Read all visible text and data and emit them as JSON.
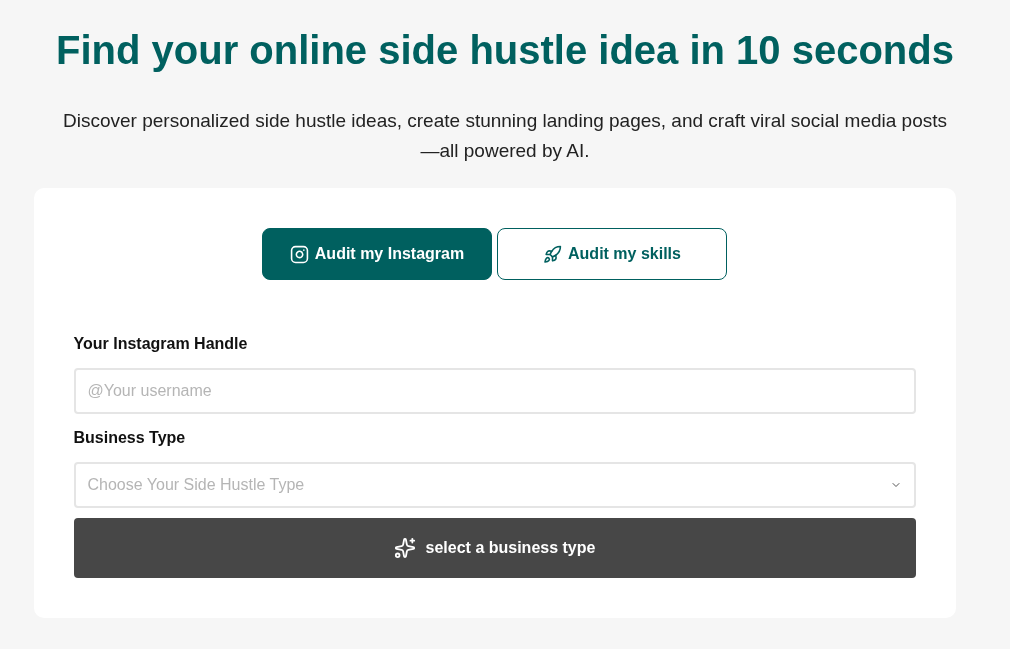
{
  "hero": {
    "title": "Find your online side hustle idea in 10 seconds",
    "subtitle": "Discover personalized side hustle ideas, create stunning landing pages, and craft viral social media posts—all powered by AI."
  },
  "tabs": [
    {
      "label": "Audit my Instagram",
      "kind": "instagram",
      "selected": true
    },
    {
      "label": "Audit my skills",
      "kind": "rocket",
      "selected": false
    }
  ],
  "form": {
    "handle": {
      "label": "Your Instagram Handle",
      "placeholder": "@Your username"
    },
    "business_type": {
      "label": "Business Type",
      "placeholder": "Choose Your Side Hustle Type"
    },
    "submit": {
      "label": "select a business type",
      "disabled": true
    }
  }
}
